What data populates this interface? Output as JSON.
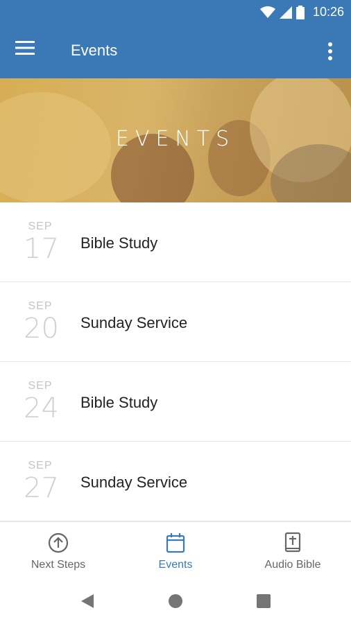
{
  "status_bar": {
    "time": "10:26"
  },
  "app_bar": {
    "title": "Events"
  },
  "hero": {
    "title": "EVENTS"
  },
  "events": [
    {
      "month": "SEP",
      "day": "17",
      "title": "Bible Study"
    },
    {
      "month": "SEP",
      "day": "20",
      "title": "Sunday Service"
    },
    {
      "month": "SEP",
      "day": "24",
      "title": "Bible Study"
    },
    {
      "month": "SEP",
      "day": "27",
      "title": "Sunday Service"
    }
  ],
  "bottom_nav": {
    "tabs": [
      {
        "label": "Next Steps",
        "icon": "arrow-up-circle-icon",
        "active": false
      },
      {
        "label": "Events",
        "icon": "calendar-icon",
        "active": true
      },
      {
        "label": "Audio Bible",
        "icon": "bible-icon",
        "active": false
      }
    ]
  },
  "colors": {
    "primary": "#3a79b5",
    "hero_tint": "#d7ae54",
    "text": "#222222",
    "muted": "#c4c4c4"
  }
}
